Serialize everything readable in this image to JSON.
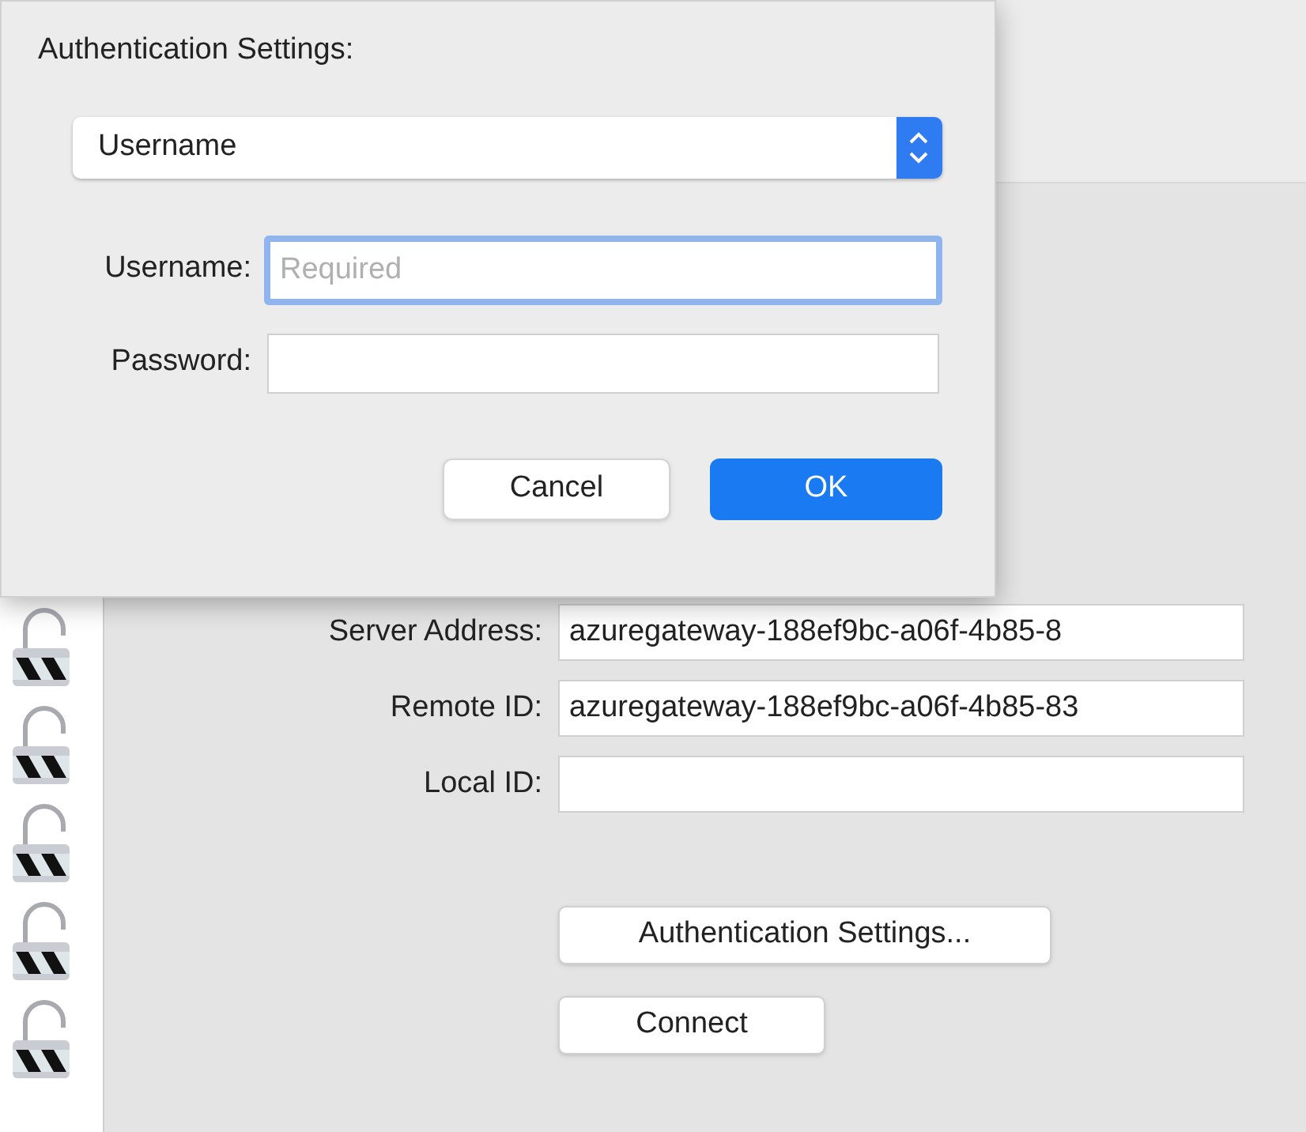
{
  "form": {
    "fields": [
      {
        "label": "Server Address:",
        "value": "azuregateway-188ef9bc-a06f-4b85-8"
      },
      {
        "label": "Remote ID:",
        "value": "azuregateway-188ef9bc-a06f-4b85-83"
      },
      {
        "label": "Local ID:"
      }
    ],
    "buttons": [
      "Authentication Settings...",
      "Connect"
    ]
  },
  "sidebar": {
    "items": [
      {
        "kind": "lock"
      },
      {
        "kind": "lock"
      },
      {
        "kind": "lock"
      },
      {
        "kind": "lock"
      },
      {
        "kind": "lock"
      }
    ]
  },
  "sheet": {
    "title": "Authentication Settings:",
    "method": "Username",
    "fields": [
      {
        "label": "Username:",
        "placeholder": "Required",
        "focused": true
      },
      {
        "label": "Password:",
        "focused": false
      }
    ],
    "buttons": [
      {
        "label": "Cancel",
        "kind": "secondary"
      },
      {
        "label": "OK",
        "kind": "primary"
      }
    ]
  }
}
